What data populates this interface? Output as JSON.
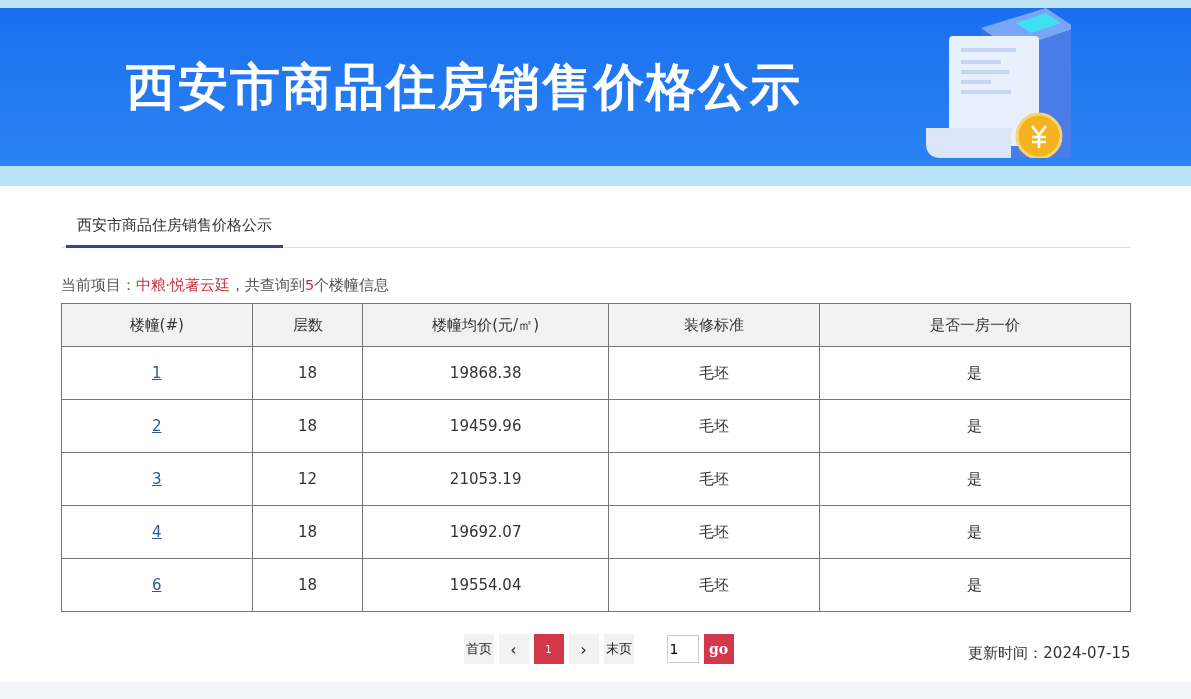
{
  "banner": {
    "title": "西安市商品住房销售价格公示"
  },
  "tabs": [
    {
      "label": "西安市商品住房销售价格公示",
      "selected": true
    }
  ],
  "summary": [
    {
      "text": "当前项目：",
      "highlight": false
    },
    {
      "text": "中粮·悦著云廷",
      "highlight": true
    },
    {
      "text": "，共查询到",
      "highlight": false
    },
    {
      "text": "5",
      "highlight": true
    },
    {
      "text": "个楼幢信息",
      "highlight": false
    }
  ],
  "table": {
    "columns": [
      "楼幢(#)",
      "层数",
      "楼幢均价(元/㎡)",
      "装修标准",
      "是否一房一价"
    ],
    "rows": [
      {
        "building": "1",
        "floors": "18",
        "avg_price": "19868.38",
        "decoration": "毛坯",
        "one_price": "是"
      },
      {
        "building": "2",
        "floors": "18",
        "avg_price": "19459.96",
        "decoration": "毛坯",
        "one_price": "是"
      },
      {
        "building": "3",
        "floors": "12",
        "avg_price": "21053.19",
        "decoration": "毛坯",
        "one_price": "是"
      },
      {
        "building": "4",
        "floors": "18",
        "avg_price": "19692.07",
        "decoration": "毛坯",
        "one_price": "是"
      },
      {
        "building": "6",
        "floors": "18",
        "avg_price": "19554.04",
        "decoration": "毛坯",
        "one_price": "是"
      }
    ]
  },
  "pagination": {
    "first": "首页",
    "prev": "‹",
    "pages": [
      {
        "label": "1",
        "selected": true
      }
    ],
    "next": "›",
    "last": "末页",
    "jump_value": "1",
    "go": "go"
  },
  "updated": "更新时间：2024-07-15"
}
